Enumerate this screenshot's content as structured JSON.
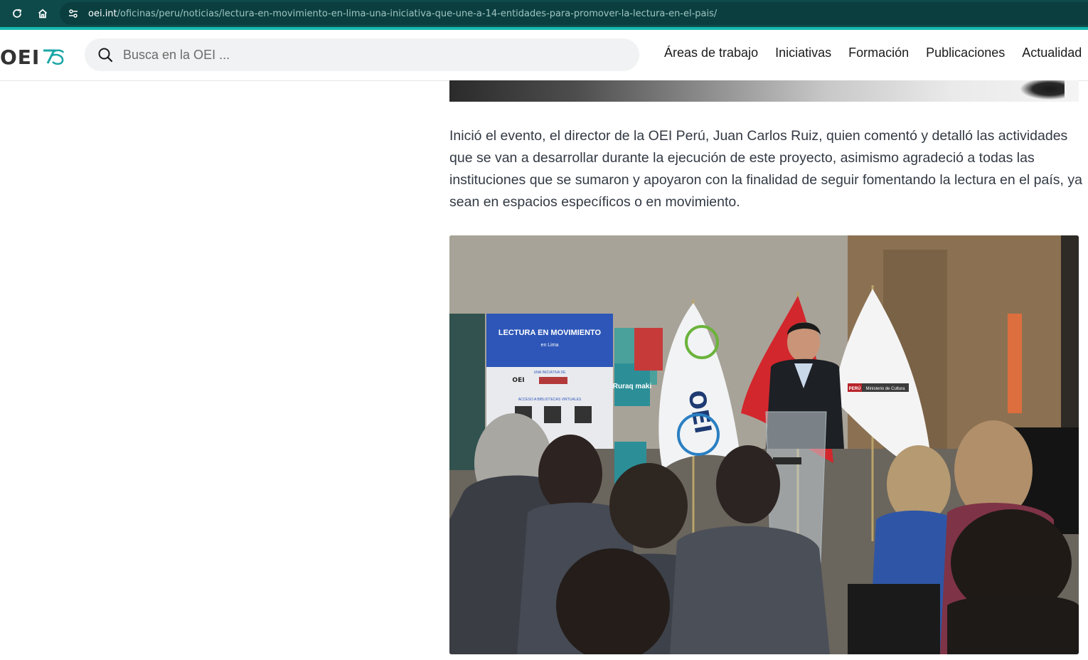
{
  "browser": {
    "url_domain": "oei.int",
    "url_path": "/oficinas/peru/noticias/lectura-en-movimiento-en-lima-una-iniciativa-que-une-a-14-entidades-para-promover-la-lectura-en-el-pais/",
    "reload_icon": "reload-icon",
    "home_icon": "home-icon",
    "site_info_icon": "site-info-icon"
  },
  "header": {
    "logo_text": "OEI",
    "search_placeholder": "Busca en la OEI ...",
    "nav": [
      "Áreas de trabajo",
      "Iniciativas",
      "Formación",
      "Publicaciones",
      "Actualidad"
    ]
  },
  "article": {
    "paragraph": "Inició el evento, el director de la OEI Perú, Juan Carlos Ruiz, quien comentó y detalló las actividades que se van a desarrollar durante la ejecución de este proyecto, asimismo agradeció a todas las instituciones que se sumaron y apoyaron con la finalidad de seguir fomentando la lectura en el país, ya sean en espacios específicos o en movimiento."
  },
  "photo": {
    "banner_title": "LECTURA EN MOVIMIENTO",
    "banner_subtitle": "en Lima",
    "banner_initiative": "UNA INICIATIVA DE",
    "banner_access": "ACCESO A BIBLIOTECAS VIRTUALES",
    "banner_logo": "OEI",
    "ministry_label": "Ministerio de Cultura",
    "peru_label": "PERÚ",
    "poster_text": "Ruraq maki",
    "flag_text": "OEI"
  },
  "colors": {
    "browser_bar": "#0f4a4a",
    "accent_teal": "#15b8b0",
    "text": "#333a44"
  }
}
